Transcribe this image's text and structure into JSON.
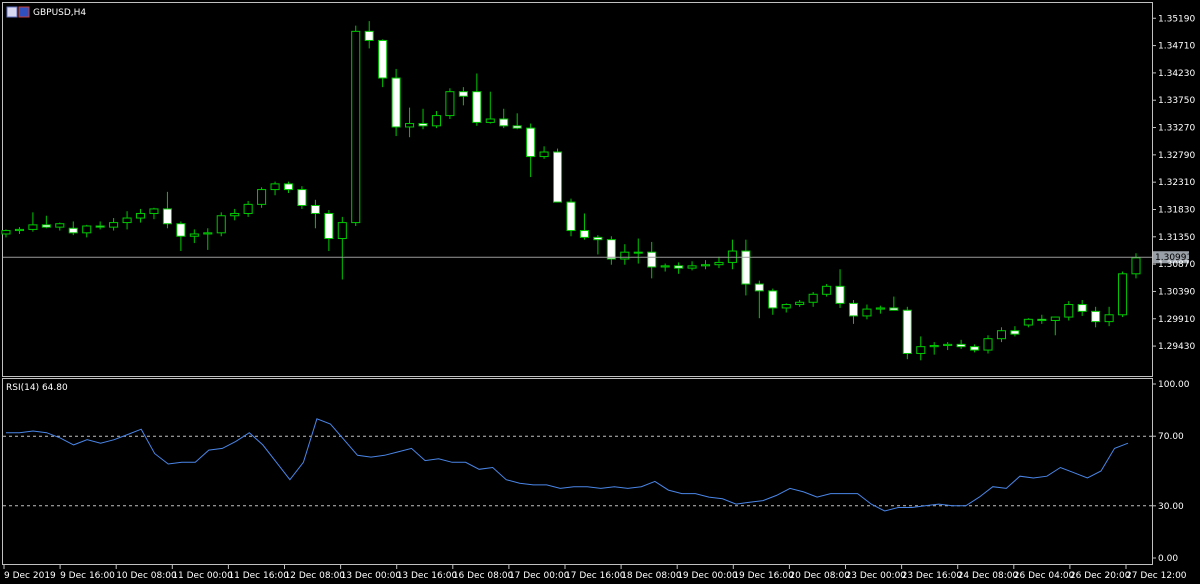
{
  "window": {
    "title": "GBPUSD,H4",
    "indicator_label": "RSI(14) 64.80"
  },
  "colors": {
    "background": "#000000",
    "frame": "#c0c0c0",
    "bull_body": "#000000",
    "bear_body": "#ffffff",
    "wick": "#00c800",
    "rsi_line": "#4a86e8",
    "bid_line": "#9a9a9a",
    "current_price_bg": "#9aa0a8"
  },
  "price_axis": {
    "ticks": [
      "1.35190",
      "1.34710",
      "1.34230",
      "1.33750",
      "1.33270",
      "1.32790",
      "1.32310",
      "1.31830",
      "1.31350",
      "1.30870",
      "1.30390",
      "1.29910",
      "1.29430"
    ],
    "current_price": "1.30991"
  },
  "rsi_axis": {
    "ticks": [
      "100.00",
      "70.00",
      "30.00",
      "0.00"
    ],
    "levels": [
      70,
      30
    ]
  },
  "time_axis": {
    "labels": [
      "9 Dec 2019",
      "9 Dec 16:00",
      "10 Dec 08:00",
      "11 Dec 00:00",
      "11 Dec 16:00",
      "12 Dec 08:00",
      "13 Dec 00:00",
      "13 Dec 16:00",
      "16 Dec 08:00",
      "17 Dec 00:00",
      "17 Dec 16:00",
      "18 Dec 08:00",
      "19 Dec 00:00",
      "19 Dec 16:00",
      "20 Dec 08:00",
      "23 Dec 00:00",
      "23 Dec 16:00",
      "24 Dec 08:00",
      "26 Dec 04:00",
      "26 Dec 20:00",
      "27 Dec 12:00"
    ]
  },
  "chart_data": [
    {
      "type": "candlestick",
      "symbol": "GBPUSD",
      "timeframe": "H4",
      "ylim": [
        1.2908,
        1.353
      ],
      "candles": [
        {
          "o": 1.314,
          "h": 1.3148,
          "l": 1.3134,
          "c": 1.3146
        },
        {
          "o": 1.3146,
          "h": 1.3152,
          "l": 1.314,
          "c": 1.3148
        },
        {
          "o": 1.3148,
          "h": 1.3178,
          "l": 1.3144,
          "c": 1.3156
        },
        {
          "o": 1.3156,
          "h": 1.3172,
          "l": 1.315,
          "c": 1.3152
        },
        {
          "o": 1.3152,
          "h": 1.316,
          "l": 1.3146,
          "c": 1.3158
        },
        {
          "o": 1.315,
          "h": 1.3162,
          "l": 1.3138,
          "c": 1.3142
        },
        {
          "o": 1.3142,
          "h": 1.3156,
          "l": 1.3134,
          "c": 1.3154
        },
        {
          "o": 1.3154,
          "h": 1.3162,
          "l": 1.3148,
          "c": 1.3152
        },
        {
          "o": 1.3152,
          "h": 1.3168,
          "l": 1.3146,
          "c": 1.316
        },
        {
          "o": 1.316,
          "h": 1.318,
          "l": 1.3148,
          "c": 1.3168
        },
        {
          "o": 1.3168,
          "h": 1.3184,
          "l": 1.316,
          "c": 1.3176
        },
        {
          "o": 1.3176,
          "h": 1.3186,
          "l": 1.3166,
          "c": 1.3184
        },
        {
          "o": 1.3184,
          "h": 1.3214,
          "l": 1.315,
          "c": 1.3158
        },
        {
          "o": 1.3158,
          "h": 1.3162,
          "l": 1.311,
          "c": 1.3136
        },
        {
          "o": 1.3136,
          "h": 1.3148,
          "l": 1.3124,
          "c": 1.314
        },
        {
          "o": 1.314,
          "h": 1.315,
          "l": 1.3112,
          "c": 1.3142
        },
        {
          "o": 1.3142,
          "h": 1.3178,
          "l": 1.3136,
          "c": 1.3172
        },
        {
          "o": 1.3172,
          "h": 1.3184,
          "l": 1.3164,
          "c": 1.3176
        },
        {
          "o": 1.3176,
          "h": 1.3198,
          "l": 1.317,
          "c": 1.3192
        },
        {
          "o": 1.3192,
          "h": 1.3222,
          "l": 1.3186,
          "c": 1.3218
        },
        {
          "o": 1.3218,
          "h": 1.3232,
          "l": 1.3208,
          "c": 1.3228
        },
        {
          "o": 1.3228,
          "h": 1.3232,
          "l": 1.3212,
          "c": 1.3218
        },
        {
          "o": 1.3218,
          "h": 1.3224,
          "l": 1.3184,
          "c": 1.319
        },
        {
          "o": 1.319,
          "h": 1.32,
          "l": 1.315,
          "c": 1.3176
        },
        {
          "o": 1.3176,
          "h": 1.3182,
          "l": 1.311,
          "c": 1.3132
        },
        {
          "o": 1.3132,
          "h": 1.317,
          "l": 1.306,
          "c": 1.316
        },
        {
          "o": 1.316,
          "h": 1.3506,
          "l": 1.3154,
          "c": 1.3496
        },
        {
          "o": 1.3496,
          "h": 1.3514,
          "l": 1.3466,
          "c": 1.348
        },
        {
          "o": 1.348,
          "h": 1.3482,
          "l": 1.3398,
          "c": 1.3414
        },
        {
          "o": 1.3414,
          "h": 1.343,
          "l": 1.3312,
          "c": 1.3328
        },
        {
          "o": 1.3328,
          "h": 1.3362,
          "l": 1.331,
          "c": 1.3334
        },
        {
          "o": 1.3334,
          "h": 1.336,
          "l": 1.3324,
          "c": 1.333
        },
        {
          "o": 1.333,
          "h": 1.3356,
          "l": 1.3326,
          "c": 1.3348
        },
        {
          "o": 1.3348,
          "h": 1.3396,
          "l": 1.3342,
          "c": 1.339
        },
        {
          "o": 1.339,
          "h": 1.3398,
          "l": 1.3366,
          "c": 1.3382
        },
        {
          "o": 1.339,
          "h": 1.3422,
          "l": 1.333,
          "c": 1.3336
        },
        {
          "o": 1.3336,
          "h": 1.339,
          "l": 1.3334,
          "c": 1.3342
        },
        {
          "o": 1.3342,
          "h": 1.336,
          "l": 1.3326,
          "c": 1.333
        },
        {
          "o": 1.333,
          "h": 1.3352,
          "l": 1.3324,
          "c": 1.3326
        },
        {
          "o": 1.3326,
          "h": 1.3334,
          "l": 1.324,
          "c": 1.3276
        },
        {
          "o": 1.3276,
          "h": 1.3294,
          "l": 1.3272,
          "c": 1.3284
        },
        {
          "o": 1.3284,
          "h": 1.329,
          "l": 1.3206,
          "c": 1.3196
        },
        {
          "o": 1.3196,
          "h": 1.3202,
          "l": 1.3136,
          "c": 1.3146
        },
        {
          "o": 1.3146,
          "h": 1.3176,
          "l": 1.313,
          "c": 1.3134
        },
        {
          "o": 1.3134,
          "h": 1.3138,
          "l": 1.3104,
          "c": 1.313
        },
        {
          "o": 1.313,
          "h": 1.3136,
          "l": 1.3086,
          "c": 1.3096
        },
        {
          "o": 1.3096,
          "h": 1.3122,
          "l": 1.3086,
          "c": 1.3108
        },
        {
          "o": 1.3108,
          "h": 1.3132,
          "l": 1.3088,
          "c": 1.3108
        },
        {
          "o": 1.3108,
          "h": 1.3126,
          "l": 1.3062,
          "c": 1.3082
        },
        {
          "o": 1.3082,
          "h": 1.3088,
          "l": 1.3074,
          "c": 1.3084
        },
        {
          "o": 1.3084,
          "h": 1.309,
          "l": 1.307,
          "c": 1.308
        },
        {
          "o": 1.308,
          "h": 1.3092,
          "l": 1.3076,
          "c": 1.3084
        },
        {
          "o": 1.3084,
          "h": 1.3094,
          "l": 1.3078,
          "c": 1.3086
        },
        {
          "o": 1.3086,
          "h": 1.31,
          "l": 1.308,
          "c": 1.309
        },
        {
          "o": 1.309,
          "h": 1.313,
          "l": 1.3078,
          "c": 1.311
        },
        {
          "o": 1.311,
          "h": 1.313,
          "l": 1.3032,
          "c": 1.3052
        },
        {
          "o": 1.3052,
          "h": 1.3058,
          "l": 1.2992,
          "c": 1.304
        },
        {
          "o": 1.304,
          "h": 1.3044,
          "l": 1.2998,
          "c": 1.301
        },
        {
          "o": 1.301,
          "h": 1.3018,
          "l": 1.3002,
          "c": 1.3016
        },
        {
          "o": 1.3016,
          "h": 1.3024,
          "l": 1.3012,
          "c": 1.302
        },
        {
          "o": 1.302,
          "h": 1.3038,
          "l": 1.3012,
          "c": 1.3034
        },
        {
          "o": 1.3034,
          "h": 1.3052,
          "l": 1.303,
          "c": 1.3048
        },
        {
          "o": 1.3048,
          "h": 1.3078,
          "l": 1.301,
          "c": 1.3018
        },
        {
          "o": 1.3018,
          "h": 1.3024,
          "l": 1.2982,
          "c": 1.2996
        },
        {
          "o": 1.2996,
          "h": 1.3016,
          "l": 1.299,
          "c": 1.3008
        },
        {
          "o": 1.3008,
          "h": 1.3014,
          "l": 1.3,
          "c": 1.301
        },
        {
          "o": 1.301,
          "h": 1.303,
          "l": 1.3006,
          "c": 1.3006
        },
        {
          "o": 1.3006,
          "h": 1.3012,
          "l": 1.292,
          "c": 1.293
        },
        {
          "o": 1.293,
          "h": 1.296,
          "l": 1.2918,
          "c": 1.2942
        },
        {
          "o": 1.2942,
          "h": 1.295,
          "l": 1.2928,
          "c": 1.2944
        },
        {
          "o": 1.2944,
          "h": 1.295,
          "l": 1.2936,
          "c": 1.2946
        },
        {
          "o": 1.2946,
          "h": 1.2954,
          "l": 1.2938,
          "c": 1.2942
        },
        {
          "o": 1.2942,
          "h": 1.2946,
          "l": 1.2932,
          "c": 1.2936
        },
        {
          "o": 1.2936,
          "h": 1.2962,
          "l": 1.293,
          "c": 1.2956
        },
        {
          "o": 1.2956,
          "h": 1.2976,
          "l": 1.295,
          "c": 1.297
        },
        {
          "o": 1.297,
          "h": 1.2978,
          "l": 1.296,
          "c": 1.2964
        },
        {
          "o": 1.298,
          "h": 1.2992,
          "l": 1.2976,
          "c": 1.299
        },
        {
          "o": 1.299,
          "h": 1.2998,
          "l": 1.2982,
          "c": 1.2988
        },
        {
          "o": 1.2988,
          "h": 1.2994,
          "l": 1.2962,
          "c": 1.2994
        },
        {
          "o": 1.2994,
          "h": 1.3022,
          "l": 1.2988,
          "c": 1.3016
        },
        {
          "o": 1.3016,
          "h": 1.3024,
          "l": 1.2996,
          "c": 1.3004
        },
        {
          "o": 1.3004,
          "h": 1.3012,
          "l": 1.2976,
          "c": 1.2986
        },
        {
          "o": 1.2986,
          "h": 1.3012,
          "l": 1.2978,
          "c": 1.2998
        },
        {
          "o": 1.2998,
          "h": 1.3074,
          "l": 1.2994,
          "c": 1.307
        },
        {
          "o": 1.307,
          "h": 1.3106,
          "l": 1.3062,
          "c": 1.3098
        }
      ]
    },
    {
      "type": "line",
      "name": "RSI(14)",
      "ylim": [
        0,
        100
      ],
      "levels": [
        70,
        30
      ],
      "values": [
        72,
        72,
        73,
        72,
        69,
        65,
        68,
        66,
        68,
        71,
        74,
        60,
        54,
        55,
        55,
        62,
        63,
        67,
        72,
        65,
        55,
        45,
        55,
        80,
        77,
        68,
        59,
        58,
        59,
        61,
        63,
        56,
        57,
        55,
        55,
        51,
        52,
        45,
        43,
        42,
        42,
        40,
        41,
        41,
        40,
        41,
        40,
        41,
        44,
        39,
        37,
        37,
        35,
        34,
        31,
        32,
        33,
        36,
        40,
        38,
        35,
        37,
        37,
        37,
        31,
        27,
        29,
        29,
        30,
        31,
        30,
        30,
        35,
        41,
        40,
        47,
        46,
        47,
        52,
        49,
        46,
        50,
        63,
        66
      ]
    }
  ]
}
